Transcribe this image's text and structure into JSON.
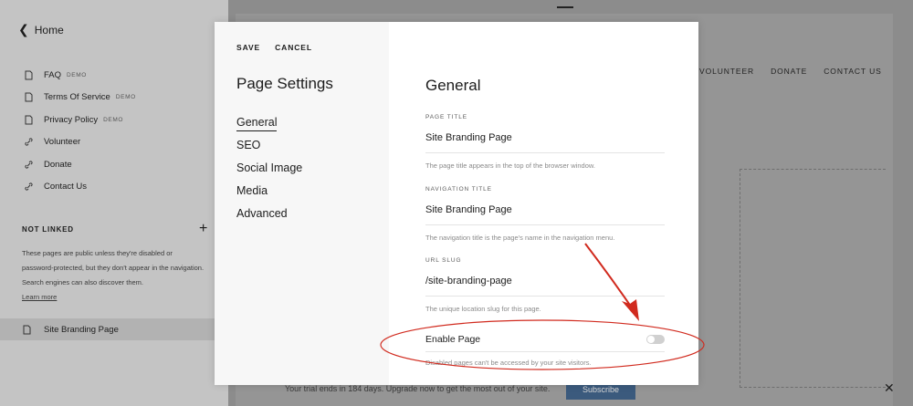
{
  "sidebar": {
    "home_label": "Home",
    "items": [
      {
        "label": "FAQ",
        "tag": "DEMO",
        "icon": "page-icon"
      },
      {
        "label": "Terms Of Service",
        "tag": "DEMO",
        "icon": "page-icon"
      },
      {
        "label": "Privacy Policy",
        "tag": "DEMO",
        "icon": "page-icon"
      },
      {
        "label": "Volunteer",
        "tag": "",
        "icon": "link-icon"
      },
      {
        "label": "Donate",
        "tag": "",
        "icon": "link-icon"
      },
      {
        "label": "Contact Us",
        "tag": "",
        "icon": "link-icon"
      }
    ],
    "not_linked_heading": "NOT LINKED",
    "not_linked_desc": "These pages are public unless they're disabled or password-protected, but they don't appear in the navigation. Search engines can also discover them.",
    "learn_more": "Learn more",
    "branding_page": "Site Branding Page"
  },
  "preview": {
    "nav": [
      "VOLUNTEER",
      "DONATE",
      "CONTACT US"
    ]
  },
  "trial": {
    "text": "Your trial ends in 184 days. Upgrade now to get the most out of your site.",
    "button": "Subscribe"
  },
  "modal": {
    "save": "SAVE",
    "cancel": "CANCEL",
    "title": "Page Settings",
    "nav": [
      "General",
      "SEO",
      "Social Image",
      "Media",
      "Advanced"
    ],
    "section_title": "General",
    "fields": [
      {
        "label": "PAGE TITLE",
        "value": "Site Branding Page",
        "help": "The page title appears in the top of the browser window."
      },
      {
        "label": "NAVIGATION TITLE",
        "value": "Site Branding Page",
        "help": "The navigation title is the page's name in the navigation menu."
      },
      {
        "label": "URL SLUG",
        "value": "/site-branding-page",
        "help": "The unique location slug for this page."
      }
    ],
    "enable_label": "Enable Page",
    "enable_on": false,
    "enable_help": "Disabled pages can't be accessed by your site visitors."
  },
  "colors": {
    "annotation": "#d12a1e",
    "subscribe": "#3b5a7d"
  }
}
